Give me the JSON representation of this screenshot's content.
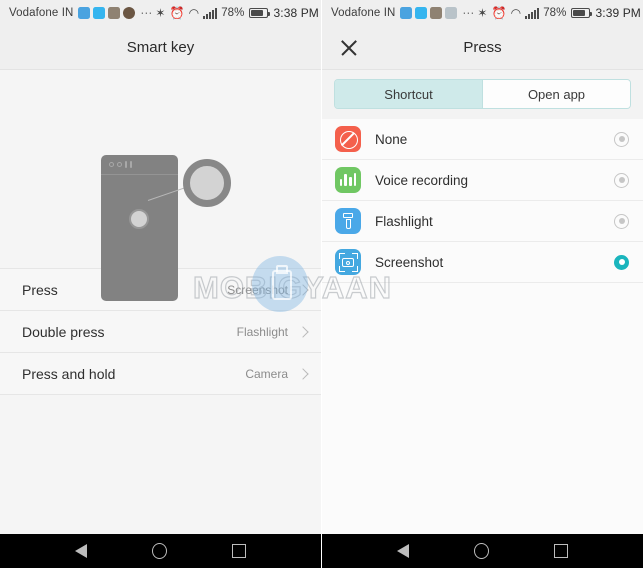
{
  "left": {
    "statusbar": {
      "carrier": "Vodafone IN",
      "overflow": "⋯",
      "bluetooth": "✶",
      "alarm": "⏰",
      "wifi": "◠",
      "battery_pct": "78%",
      "time": "3:38 PM",
      "notif_icons": [
        "photo-notification-icon",
        "message-notification-icon",
        "gallery-notification-icon",
        "contact-avatar-icon"
      ]
    },
    "title": "Smart key",
    "illustration": {
      "name": "phone-back-fingerprint-illustration",
      "phone_body": "phone-body",
      "sensor": "fingerprint-sensor",
      "callout": "fingerprint-sensor-callout"
    },
    "rows": [
      {
        "label": "Press",
        "value": "Screenshot",
        "chevron": true
      },
      {
        "label": "Double press",
        "value": "Flashlight",
        "chevron": true
      },
      {
        "label": "Press and hold",
        "value": "Camera",
        "chevron": true
      }
    ]
  },
  "right": {
    "statusbar": {
      "carrier": "Vodafone IN",
      "overflow": "⋯",
      "bluetooth": "✶",
      "alarm": "⏰",
      "wifi": "◠",
      "battery_pct": "78%",
      "time": "3:39 PM",
      "notif_icons": [
        "photo-notification-icon",
        "message-notification-icon",
        "gallery-notification-icon",
        "screenshot-notification-icon"
      ]
    },
    "title": "Press",
    "close_icon": "close-icon",
    "tabs": [
      {
        "label": "Shortcut",
        "active": true
      },
      {
        "label": "Open app",
        "active": false
      }
    ],
    "options": [
      {
        "label": "None",
        "icon": "prohibition-icon",
        "icon_color": "#f4604c",
        "selected": false
      },
      {
        "label": "Voice recording",
        "icon": "equalizer-icon",
        "icon_color": "#70c763",
        "selected": false
      },
      {
        "label": "Flashlight",
        "icon": "flashlight-icon",
        "icon_color": "#4aa8e8",
        "selected": false
      },
      {
        "label": "Screenshot",
        "icon": "camera-icon",
        "icon_color": "#44a8e0",
        "selected": true
      }
    ]
  },
  "navbar": {
    "back": "back-icon",
    "home": "home-icon",
    "recents": "recents-icon"
  },
  "watermark": {
    "text": "MOBIGYAAN"
  },
  "colors": {
    "accent_teal": "#1ab5bd",
    "tab_active_bg": "#cfeaea",
    "screen_bg": "#f5f5f5",
    "statusbar_bg": "#efefef"
  }
}
